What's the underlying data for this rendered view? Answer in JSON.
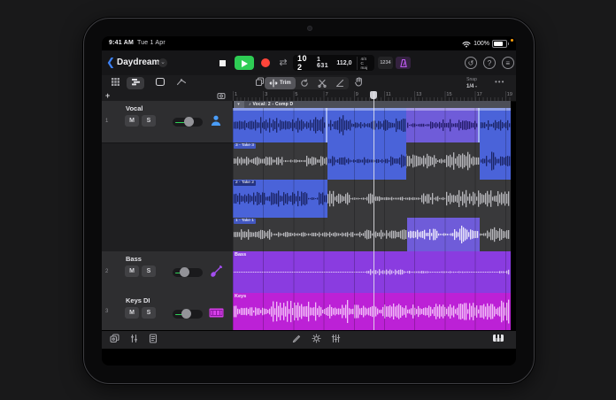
{
  "status": {
    "time": "9:41 AM",
    "date": "Tue 1 Apr",
    "battery": "100%"
  },
  "header": {
    "project_title": "Daydream"
  },
  "lcd": {
    "position_main": "10 2",
    "position_sub": "1 631",
    "tempo": "112,0",
    "time_signature": "4/4",
    "key": "C maj",
    "count_in": "1234"
  },
  "edit_toolbar": {
    "function_selected_label": "Trim",
    "snap_label": "Snap",
    "snap_value": "1/4",
    "more_label": "•••"
  },
  "ruler": {
    "bars": [
      "1",
      "3",
      "5",
      "7",
      "9",
      "11",
      "13",
      "15",
      "17",
      "19"
    ]
  },
  "arrange": {
    "folder_title": "Vocal: 2 - Comp D",
    "folder_icon": "♪",
    "takes": [
      {
        "label": "3 - Take 3"
      },
      {
        "label": "2 - Take 2"
      },
      {
        "label": "1 - Take 1"
      }
    ],
    "region_bass_label": "Bass",
    "region_keys_label": "Keys"
  },
  "tracks": [
    {
      "num": "1",
      "name": "Vocal",
      "mute": "M",
      "solo": "S"
    },
    {
      "num": "2",
      "name": "Bass",
      "mute": "M",
      "solo": "S"
    },
    {
      "num": "3",
      "name": "Keys DI",
      "mute": "M",
      "solo": "S"
    }
  ],
  "colors": {
    "region_blue": "#4a63d9",
    "region_purple": "#6f5cd9",
    "region_bass": "#8a3ce0",
    "region_keys": "#bc21d6",
    "play_green": "#2ecc54",
    "record_red": "#ff453a",
    "metronome_purple": "#bf5af2",
    "lane_gray": "#39393b"
  }
}
